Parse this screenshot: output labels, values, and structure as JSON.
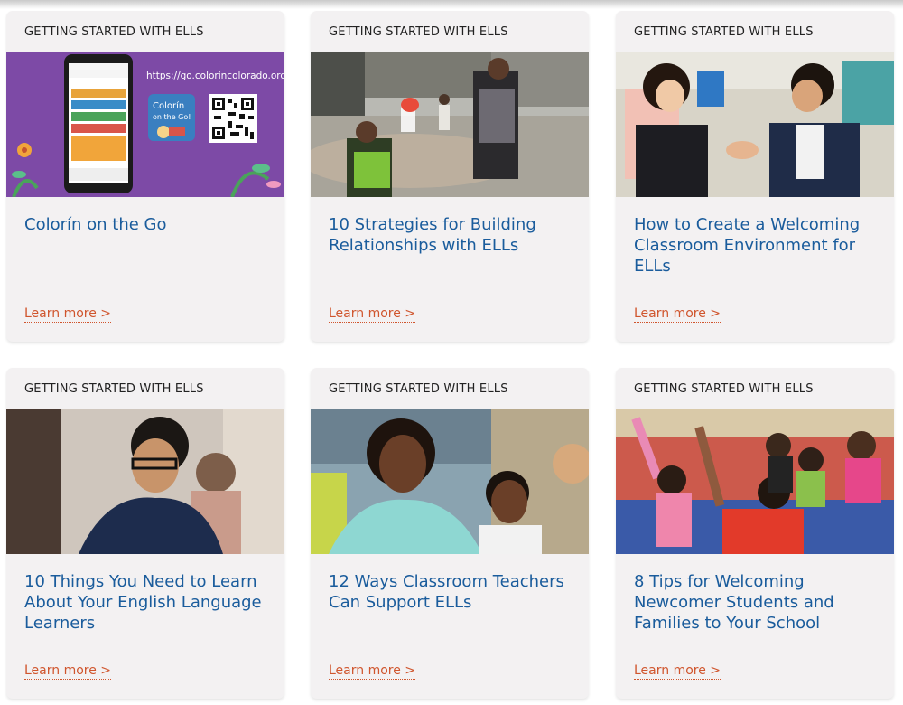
{
  "cards": [
    {
      "label": "GETTING STARTED WITH ELLS",
      "title": "Colorín on the Go",
      "link": "Learn more >",
      "image": {
        "url_text": "https://go.colorincolorado.org/",
        "badge_line1": "Colorín",
        "badge_line2": "on the Go!"
      }
    },
    {
      "label": "GETTING STARTED WITH ELLS",
      "title": "10 Strategies for Building Relationships with ELLs",
      "link": "Learn more >"
    },
    {
      "label": "GETTING STARTED WITH ELLS",
      "title": "How to Create a Welcoming Classroom Environment for ELLs",
      "link": "Learn more >"
    },
    {
      "label": "GETTING STARTED WITH ELLS",
      "title": "10 Things You Need to Learn About Your English Language Learners",
      "link": "Learn more >"
    },
    {
      "label": "GETTING STARTED WITH ELLS",
      "title": "12 Ways Classroom Teachers Can Support ELLs",
      "link": "Learn more >"
    },
    {
      "label": "GETTING STARTED WITH ELLS",
      "title": "8 Tips for Welcoming Newcomer Students and Families to Your School",
      "link": "Learn more >"
    }
  ],
  "colors": {
    "label": "#222222",
    "title": "#1a5c9c",
    "link": "#d0552d",
    "card_bg": "#f3f1f2",
    "promo_purple": "#7d4aa6"
  }
}
